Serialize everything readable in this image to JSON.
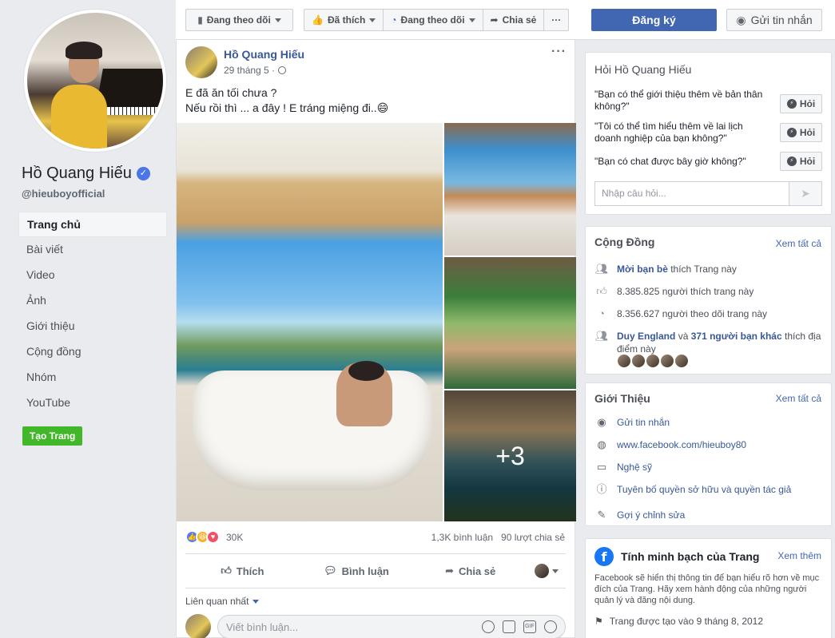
{
  "profile": {
    "name": "Hồ Quang Hiếu",
    "username": "@hieuboyofficial",
    "verified_icon": "check",
    "nav": [
      "Trang chủ",
      "Bài viết",
      "Video",
      "Ảnh",
      "Giới thiệu",
      "Cộng đồng",
      "Nhóm",
      "YouTube"
    ],
    "create_page": "Tạo Trang"
  },
  "topbar": {
    "following": "Đang theo dõi",
    "liked": "Đã thích",
    "following2": "Đang theo dõi",
    "share": "Chia sẻ",
    "more": "···",
    "signup": "Đăng ký",
    "message": "Gửi tin nhắn"
  },
  "post": {
    "author": "Hồ Quang Hiếu",
    "date": "29 tháng 5 ·",
    "text_line1": "E đã ăn tối chưa ?",
    "text_line2": "Nếu rồi thì ... a đây ! E tráng miệng đi..😄",
    "more_photos": "+3",
    "reactions_count": "30K",
    "comments_count": "1,3K bình luận",
    "shares_count": "90 lượt chia sẻ",
    "actions": {
      "like": "Thích",
      "comment": "Bình luận",
      "share": "Chia sẻ"
    },
    "sort_label": "Liên quan nhất",
    "comment_placeholder": "Viết bình luận..."
  },
  "ask": {
    "title": "Hỏi Hồ Quang Hiếu",
    "questions": [
      "\"Bạn có thể giới thiệu thêm về bản thân không?\"",
      "\"Tôi có thể tìm hiểu thêm về lai lịch doanh nghiệp của bạn không?\"",
      "\"Bạn có chat được bây giờ không?\""
    ],
    "ask_button": "Hỏi",
    "input_placeholder": "Nhập câu hỏi..."
  },
  "community": {
    "title": "Cộng Đồng",
    "see_all": "Xem tất cả",
    "invite_link": "Mời bạn bè",
    "invite_rest": "thích Trang này",
    "likes": "8.385.825 người thích trang này",
    "followers": "8.356.627 người theo dõi trang này",
    "friend_name": "Duy England",
    "friend_and": "và",
    "friend_others": "371 người bạn khác",
    "friend_rest": "thích địa điểm này"
  },
  "intro": {
    "title": "Giới Thiệu",
    "see_all": "Xem tất cả",
    "items": [
      "Gửi tin nhắn",
      "www.facebook.com/hieuboy80",
      "Nghệ sỹ",
      "Tuyên bố quyền sở hữu và quyền tác giả",
      "Gợi ý chỉnh sửa"
    ]
  },
  "transparency": {
    "title": "Tính minh bạch của Trang",
    "see_more": "Xem thêm",
    "description": "Facebook sẽ hiển thị thông tin để bạn hiểu rõ hơn về mục đích của Trang. Hãy xem hành động của những người quản lý và đăng nội dung.",
    "created": "Trang được tạo vào 9 tháng 8, 2012"
  }
}
